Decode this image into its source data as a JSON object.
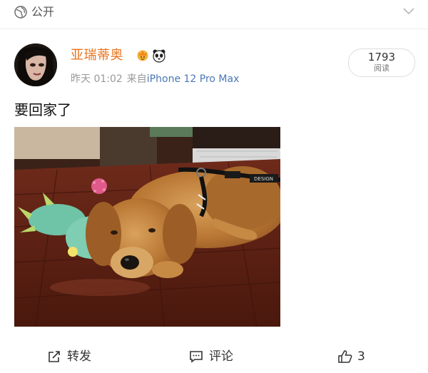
{
  "header": {
    "visibility_label": "公开",
    "visibility_icon": "globe-icon",
    "menu_icon": "chevron-down-icon"
  },
  "post": {
    "author": "亚瑞蒂奥",
    "badges": [
      "crown-badge-icon",
      "panda-badge-icon"
    ],
    "time": "昨天 01:02",
    "source_prefix": "来自",
    "device": "iPhone 12 Pro Max",
    "views_count": "1793",
    "views_label": "阅读",
    "text": "要回家了"
  },
  "actions": {
    "repost_label": "转发",
    "comment_label": "评论",
    "like_count": "3"
  },
  "colors": {
    "username": "#e8731e",
    "device_link": "#4a78b4",
    "meta": "#999999"
  }
}
